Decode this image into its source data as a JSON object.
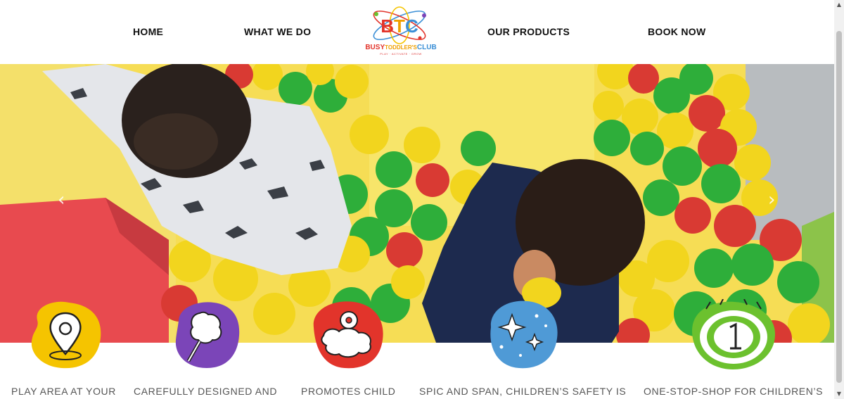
{
  "nav": {
    "home": "HOME",
    "what_we_do": "WHAT WE DO",
    "our_products": "OUR PRODUCTS",
    "book_now": "BOOK NOW"
  },
  "logo": {
    "monogram": "BTC",
    "busy": "BUSY",
    "toddlers": "TODDLER'S",
    "club": "CLUB",
    "tagline": "PLAY · ACTIVATE · GROW"
  },
  "hero": {
    "prev_arrow": "‹",
    "next_arrow": "›"
  },
  "features": [
    {
      "icon": "location-pin-icon",
      "color": "#f5c400",
      "label": "PLAY AREA AT YOUR"
    },
    {
      "icon": "brain-pencil-icon",
      "color": "#7b45b8",
      "label": "CAREFULLY DESIGNED AND"
    },
    {
      "icon": "brain-gear-icon",
      "color": "#e2342b",
      "label": "PROMOTES CHILD"
    },
    {
      "icon": "sparkles-icon",
      "color": "#4f9ad6",
      "label": "SPIC AND SPAN, CHILDREN’S SAFETY IS"
    },
    {
      "icon": "number-one-badge-icon",
      "color": "#6cc12e",
      "label": "ONE-STOP-SHOP FOR CHILDREN’S"
    }
  ],
  "colors": {
    "red": "#d93a33",
    "green": "#2eae3a",
    "yellow": "#f2d51e",
    "navy": "#1d2a4e"
  }
}
